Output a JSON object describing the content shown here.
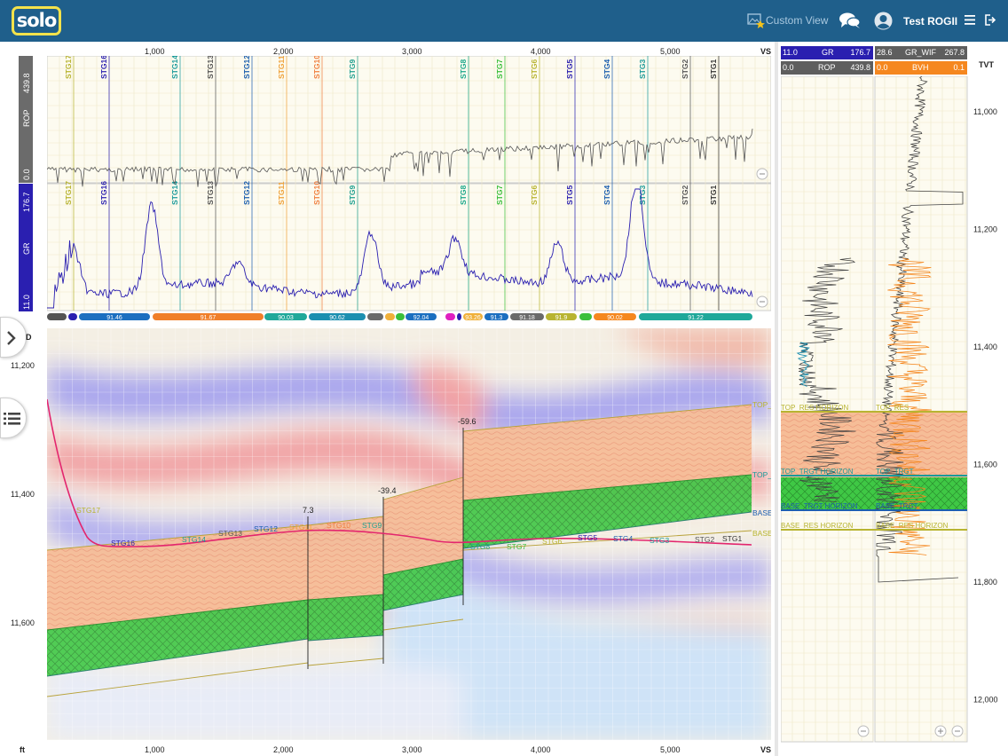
{
  "app": {
    "logo_text": "solo",
    "custom_view_label": "Custom View",
    "user_name": "Test ROGII"
  },
  "colors": {
    "header_bg": "#1f5f8b",
    "accent_yellow": "#f3e24b",
    "gr_line": "#2a1fb0",
    "rop_line": "#555555",
    "trajectory": "#e3266e",
    "target_zone": "#2fbf3a",
    "zone_fill": "#f6b58c"
  },
  "icons": {
    "custom_view": "picture-star-icon",
    "chat": "chat-bubbles-icon",
    "user": "user-avatar-icon",
    "menu": "hamburger-menu-icon",
    "logout": "logout-icon",
    "expand": "chevron-right-icon",
    "list": "list-icon",
    "zoom_out": "minus-circle-icon",
    "zoom_in": "plus-circle-icon"
  },
  "top_axis": {
    "ticks": [
      "1,000",
      "2,000",
      "3,000",
      "4,000",
      "5,000"
    ],
    "unit": "VS"
  },
  "bottom_axis": {
    "ticks": [
      "1,000",
      "2,000",
      "3,000",
      "4,000",
      "5,000"
    ],
    "unit": "VS",
    "left_unit": "ft"
  },
  "rop_track": {
    "name": "ROP",
    "max": "439.8",
    "min": "0.0"
  },
  "gr_track": {
    "name": "GR",
    "max": "176.7",
    "min": "11.0"
  },
  "stages": [
    "STG17",
    "STG16",
    "STG14",
    "STG13",
    "STG12",
    "STG11",
    "STG10",
    "STG9",
    "STG8",
    "STG7",
    "STG6",
    "STG5",
    "STG4",
    "STG3",
    "STG2",
    "STG1"
  ],
  "dip_bar": [
    "91.46",
    "91.67",
    "90.03",
    "90.62",
    "92.04",
    "93.26",
    "91.3",
    "91.18",
    "91.9",
    "90.02",
    "91.22"
  ],
  "section": {
    "tvd_ticks": [
      "11,200",
      "11,400",
      "11,600"
    ],
    "tvd_label": "D",
    "fault_labels": [
      "7.3",
      "-39.4",
      "-59.6"
    ],
    "horizon_labels": [
      "TOP_",
      "TOP_",
      "BASE",
      "BASE"
    ]
  },
  "right_panel": {
    "header_rows": [
      {
        "min": "11.0",
        "name": "GR",
        "max": "176.7"
      },
      {
        "min": "0.0",
        "name": "ROP",
        "max": "439.8"
      }
    ],
    "header_rows2": [
      {
        "min": "28.6",
        "name": "GR_WIF",
        "max": "267.8"
      },
      {
        "min": "0.0",
        "name": "BVH",
        "max": "0.1"
      }
    ],
    "tvt_label": "TVT",
    "tvt_ticks": [
      "11,000",
      "11,200",
      "11,400",
      "11,600",
      "11,800",
      "12,000"
    ],
    "horizons": [
      "TOP_RES HORIZON",
      "TOP_TRGT HORIZON",
      "BASE_TRGT HORIZON",
      "BASE_RES HORIZON"
    ],
    "horizons2": [
      "TOP_RES",
      "TOP_TRGT",
      "BASE_TRGT",
      "BASE_RES HORIZON"
    ]
  }
}
